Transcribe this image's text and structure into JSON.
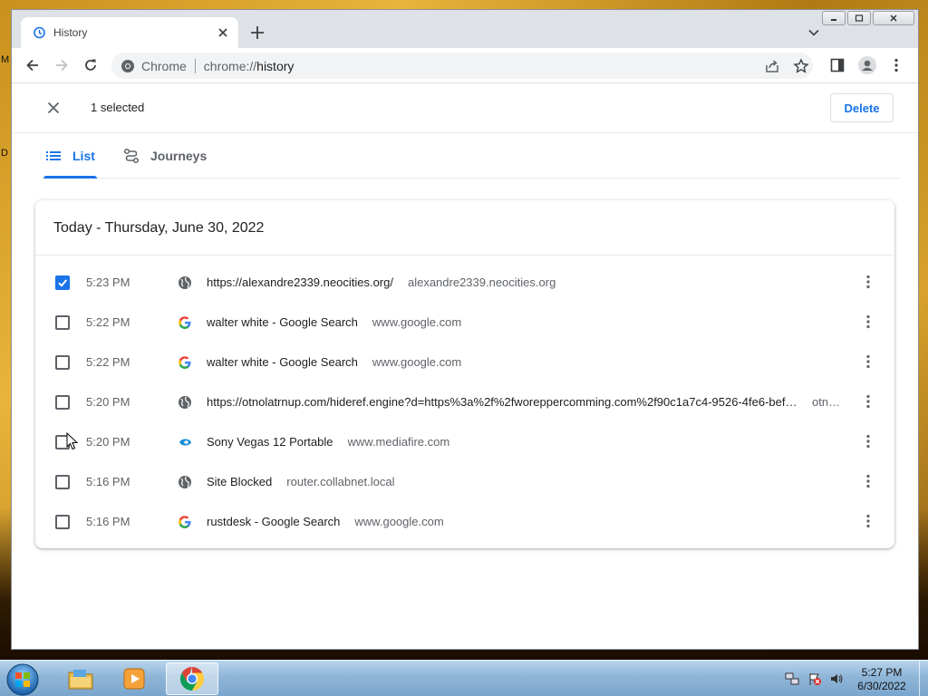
{
  "browser": {
    "tab_title": "History",
    "omnibox_chip": "Chrome",
    "url_scheme": "chrome://",
    "url_path": "history"
  },
  "history": {
    "selected_text": "1 selected",
    "delete_label": "Delete",
    "tabs": [
      {
        "label": "List",
        "active": true
      },
      {
        "label": "Journeys",
        "active": false
      }
    ],
    "date_heading": "Today - Thursday, June 30, 2022",
    "entries": [
      {
        "checked": true,
        "time": "5:23 PM",
        "favicon": "globe-icon",
        "title": "https://alexandre2339.neocities.org/",
        "domain": "alexandre2339.neocities.org"
      },
      {
        "checked": false,
        "time": "5:22 PM",
        "favicon": "google-icon",
        "title": "walter white - Google Search",
        "domain": "www.google.com"
      },
      {
        "checked": false,
        "time": "5:22 PM",
        "favicon": "google-icon",
        "title": "walter white - Google Search",
        "domain": "www.google.com"
      },
      {
        "checked": false,
        "time": "5:20 PM",
        "favicon": "globe-icon",
        "title": "https://otnolatrnup.com/hideref.engine?d=https%3a%2f%2fworeppercomming.com%2f90c1a7c4-9526-4fe6-bef…",
        "domain": "otn…"
      },
      {
        "checked": false,
        "time": "5:20 PM",
        "favicon": "mediafire-icon",
        "title": "Sony Vegas 12 Portable",
        "domain": "www.mediafire.com"
      },
      {
        "checked": false,
        "time": "5:16 PM",
        "favicon": "globe-icon",
        "title": "Site Blocked",
        "domain": "router.collabnet.local"
      },
      {
        "checked": false,
        "time": "5:16 PM",
        "favicon": "google-icon",
        "title": "rustdesk - Google Search",
        "domain": "www.google.com"
      }
    ]
  },
  "taskbar": {
    "apps": [
      "file-explorer-icon",
      "media-player-icon",
      "chrome-icon"
    ],
    "active_app": "chrome-icon",
    "clock_time": "5:27 PM",
    "clock_date": "6/30/2022"
  },
  "desktop": {
    "edge_letters": [
      "M",
      "D"
    ]
  },
  "colors": {
    "accent": "#1a73e8",
    "text_primary": "#202124",
    "text_secondary": "#5f6368"
  }
}
